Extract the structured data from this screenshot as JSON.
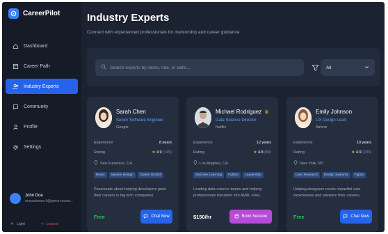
{
  "brand": {
    "name": "CareerPilot"
  },
  "nav": [
    {
      "label": "Dashboard",
      "icon": "home-icon",
      "active": false
    },
    {
      "label": "Career Path",
      "icon": "path-icon",
      "active": false
    },
    {
      "label": "Industry Experts",
      "icon": "users-icon",
      "active": true
    },
    {
      "label": "Community",
      "icon": "chat-icon",
      "active": false
    },
    {
      "label": "Profile",
      "icon": "user-icon",
      "active": false
    },
    {
      "label": "Settings",
      "icon": "gear-icon",
      "active": false
    }
  ],
  "user": {
    "name": "John Doe",
    "email": "manucitenes.lt@gmce.recont..."
  },
  "footer": {
    "light": "Light",
    "logout": "Logout"
  },
  "page": {
    "title": "Industry Experts",
    "subtitle": "Connect with experienced professionals for mentorship and career guidance"
  },
  "search": {
    "placeholder": "Search experts by name, role, or skills...",
    "filter_value": "All"
  },
  "experts": [
    {
      "name": "Sarah Chen",
      "role": "Senior Software Engineer",
      "company": "Google",
      "experience_label": "Experience",
      "experience": "8 years",
      "rating_label": "Rating",
      "rating": "4.9",
      "reviews": "(145)",
      "location": "San Francisco, CA",
      "tags": [
        "React",
        "System Design",
        "Career Growth"
      ],
      "description": "Passionate about helping developers grow their careers in big tech companies.",
      "price": "Free",
      "price_type": "free",
      "action": "Chat Now",
      "action_style": "blue"
    },
    {
      "name": "Michael Rodriguez",
      "role": "Data Science Director",
      "company": "Netflix",
      "experience_label": "Experience",
      "experience": "12 years",
      "rating_label": "Rating",
      "rating": "4.8",
      "reviews": "(89)",
      "location": "Los Angeles, CA",
      "tags": [
        "Machine Learning",
        "Python",
        "Leadership"
      ],
      "description": "Leading data science teams and helping professionals transition into AI/ML roles.",
      "price": "$150/hr",
      "price_type": "paid",
      "action": "Book Session",
      "action_style": "purple"
    },
    {
      "name": "Emily Johnson",
      "role": "UX Design Lead",
      "company": "Airbnb",
      "experience_label": "Experience",
      "experience": "10 years",
      "rating_label": "Rating",
      "rating": "4.9",
      "reviews": "(203)",
      "location": "New York, NY",
      "tags": [
        "User Research",
        "Design Systems",
        "Figma"
      ],
      "description": "Helping designers create impactful user experiences and advance their careers.",
      "price": "Free",
      "price_type": "free",
      "action": "Chat Now",
      "action_style": "blue"
    }
  ]
}
